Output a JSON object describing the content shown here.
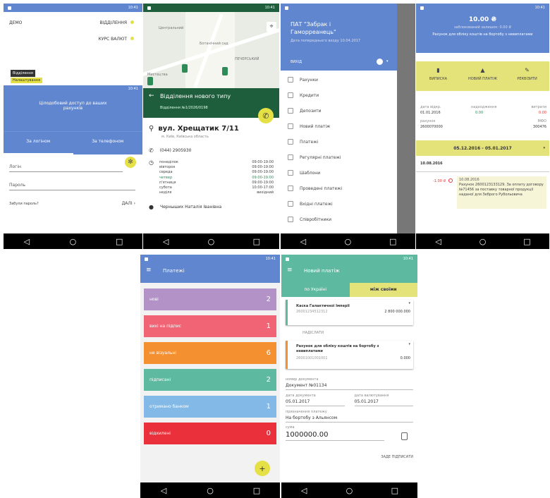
{
  "status": {
    "time": "10:41"
  },
  "nav": {
    "back": "◁",
    "home": "○",
    "recent": "□"
  },
  "login": {
    "left_top": "ДЕМО",
    "right_top1": "ВІДДІЛЕННЯ",
    "right_top2": "КУРС ВАЛЮТ",
    "tooltip1": "Відділення",
    "tooltip2": "Налаштування",
    "band_text": "10:41",
    "banner": "Цілодобовий доступ до ваших рахунків",
    "tab_login": "За логіном",
    "tab_phone": "За телефоном",
    "login_label": "Логін",
    "password_label": "Пароль",
    "forgot": "Забули пароль?",
    "next": "ДАЛІ"
  },
  "branch": {
    "map_labels": [
      "Центральний",
      "Ботанічний сад",
      "ПЕЧЕРСЬКИЙ",
      "Мистецтва"
    ],
    "title": "Відділення нового типу",
    "subtitle": "Відділення №1/2026/0198",
    "address": "вул. Хрещатик 7/11",
    "city": "м. Київ, Київська область",
    "phone": "(044) 2905930",
    "hours": [
      {
        "day": "понеділок",
        "time": "09:00-19:00"
      },
      {
        "day": "вівторок",
        "time": "09:00-19:00"
      },
      {
        "day": "середа",
        "time": "09:00-19:00"
      },
      {
        "day": "четвер",
        "time": "09:00-19:00",
        "today": true
      },
      {
        "day": "п'ятниця",
        "time": "09:00-19:00"
      },
      {
        "day": "субота",
        "time": "10:00-17:00"
      },
      {
        "day": "неділя",
        "time": "вихідний"
      }
    ],
    "manager": "Черныших Наталія Іванівна"
  },
  "drawer": {
    "company": "ПАТ \"Забрак і Гаморреанець\"",
    "subtitle": "Дата попереднього входу 10.04.2017",
    "account": "ВИХІД",
    "items": [
      "Рахунки",
      "Кредити",
      "Депозити",
      "Новий платіж",
      "Платежі",
      "Регулярні платежі",
      "Шаблони",
      "Проведені платежі",
      "Вхідні платежі",
      "Співробітники"
    ]
  },
  "account": {
    "amount": "10.00 ₴",
    "available": "заблокований залишок: 0.00 ₴",
    "name": "Рахунок для обліку коштів на бортобу з невиплатами",
    "actions": [
      "ВИПИСКА",
      "НОВИЙ ПЛАТІЖ",
      "РЕКВІЗИТИ"
    ],
    "info": [
      {
        "label": "дата відкр.",
        "value": "01.01.2016"
      },
      {
        "label": "надходження",
        "value": "0.00"
      },
      {
        "label": "витрати",
        "value": "0.00"
      },
      {
        "label": "рахунок",
        "value": "2600070000"
      },
      {
        "label": "МФО",
        "value": "300476"
      }
    ],
    "period": "05.12.2016 - 05.01.2017",
    "date_group": "10.08.2016",
    "tx_amount": "-1.00 ₴",
    "tx_date": "10.08.2016",
    "tx_text": "Рахунок 2600123133129. За оплату договору №71456 за поставку товарної продукції наданої для Зеброго Рубольовича"
  },
  "payments": {
    "title": "Платежі",
    "cats": [
      {
        "label": "нові",
        "count": "2",
        "color": "#b392c7"
      },
      {
        "label": "вихі на підпис",
        "count": "1",
        "color": "#f06476"
      },
      {
        "label": "не візуальні",
        "count": "6",
        "color": "#f59031"
      },
      {
        "label": "підписані",
        "count": "2",
        "color": "#5dbaa0"
      },
      {
        "label": "отримано банком",
        "count": "1",
        "color": "#82b9e6"
      },
      {
        "label": "відхилені",
        "count": "0",
        "color": "#e9303b"
      }
    ],
    "fab": "+"
  },
  "newpay": {
    "title": "Новий платіж",
    "tab_ukraine": "по Україні",
    "tab_own": "між своїми",
    "card1_name": "Каска Галактичної Імперії",
    "card1_acc": "26001234512312",
    "card1_amount": "2 800 000.000",
    "from_label": "НАДІСЛАТИ",
    "card2_name": "Рахунок для обліку коштів на бортобу з невиплатами",
    "card2_acc": "26001001001001",
    "card2_amount": "0.000",
    "doc_label": "номер документа",
    "doc_value": "Документ №01134",
    "date_label": "дата документа",
    "date_value": "05.01.2017",
    "val_label": "дата валютування",
    "val_value": "05.01.2017",
    "purpose_label": "призначення платежу",
    "purpose_value": "На бортобу з Альянсом",
    "sum_label": "сума",
    "sum_value": "1000000.00",
    "next": "ЗАДЕ ПІДПИСАТИ"
  }
}
